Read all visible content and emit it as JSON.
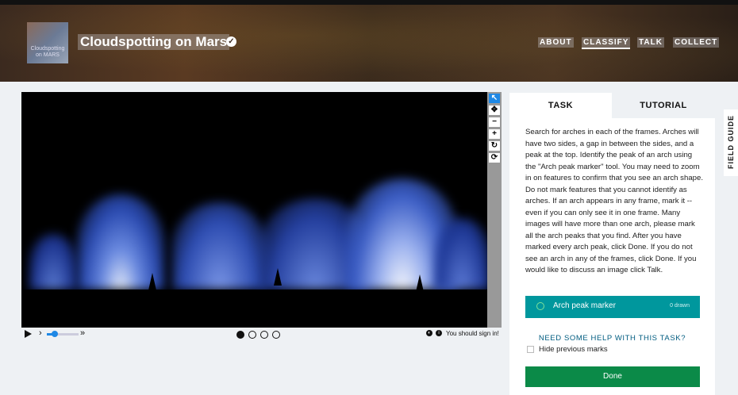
{
  "header": {
    "avatar_line1": "Cloudspotting",
    "avatar_line2": "on MARS",
    "project_title": "Cloudspotting on Mars",
    "verified_icon": "✓",
    "nav": [
      "ABOUT",
      "CLASSIFY",
      "TALK",
      "COLLECT"
    ]
  },
  "viewer": {
    "tools": [
      "pointer",
      "move",
      "zoom-out",
      "zoom-in",
      "rotate",
      "reset"
    ],
    "controls": {
      "prev_glyph": "›",
      "next_glyph": "»",
      "frames": 4,
      "current_frame": 1,
      "signin_text": "You should sign in!"
    }
  },
  "panel": {
    "tabs": [
      "TASK",
      "TUTORIAL"
    ],
    "instructions": "Search for arches in each of the frames. Arches will have two sides, a gap in between the sides, and a peak at the top. Identify the peak of an arch using the \"Arch peak marker\" tool. You may need to zoom in on features to confirm that you see an arch shape. Do not mark features that you cannot identify as arches. If an arch appears in any frame, mark it -- even if you can only see it in one frame. Many images will have more than one arch, please mark all the arch peaks that you find. After you have marked every arch peak, click Done. If you do not see an arch in any of the frames, click Done. If you would like to discuss an image click Talk.",
    "tool_label": "Arch peak marker",
    "tool_count": "0 drawn",
    "help_link": "NEED SOME HELP WITH THIS TASK?",
    "hide_marks": "Hide previous marks",
    "done": "Done"
  },
  "field_guide": "FIELD GUIDE",
  "colors": {
    "accent": "#00979d",
    "done": "#0b8a48",
    "link": "#005c80",
    "tool_blue": "#1e88e5"
  }
}
